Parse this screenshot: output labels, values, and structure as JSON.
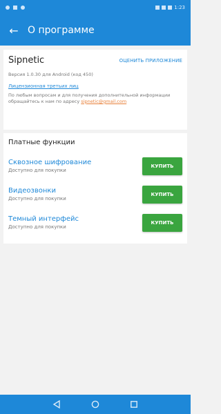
{
  "status_bar": {
    "right_text": "1:23"
  },
  "app_bar": {
    "back_icon": "←",
    "title": "О программе"
  },
  "info": {
    "app_name": "Sipnetic",
    "rate_label": "ОЦЕНИТЬ ПРИЛОЖЕНИЕ",
    "version": "Версия 1.0.30 для Android (код 450)",
    "licenses_label": "Лицензионная третьих лиц",
    "contact_text": "По любым вопросам и для получения дополнительной информации обращайтесь к нам по адресу",
    "email": "sipnetic@gmail.com"
  },
  "paid": {
    "title": "Платные функции",
    "features": [
      {
        "name": "Сквозное шифрование",
        "status": "Доступно для покупки",
        "button": "КУПИТЬ"
      },
      {
        "name": "Видеозвонки",
        "status": "Доступно для покупки",
        "button": "КУПИТЬ"
      },
      {
        "name": "Темный интерфейс",
        "status": "Доступно для покупки",
        "button": "КУПИТЬ"
      }
    ]
  },
  "colors": {
    "accent": "#1e88d8",
    "buy_green": "#3aa53f",
    "email_orange": "#e8803a"
  },
  "icons": {
    "back": "arrow-left-icon",
    "nav_back": "triangle-back-icon",
    "nav_home": "circle-home-icon",
    "nav_recent": "square-recent-icon"
  }
}
